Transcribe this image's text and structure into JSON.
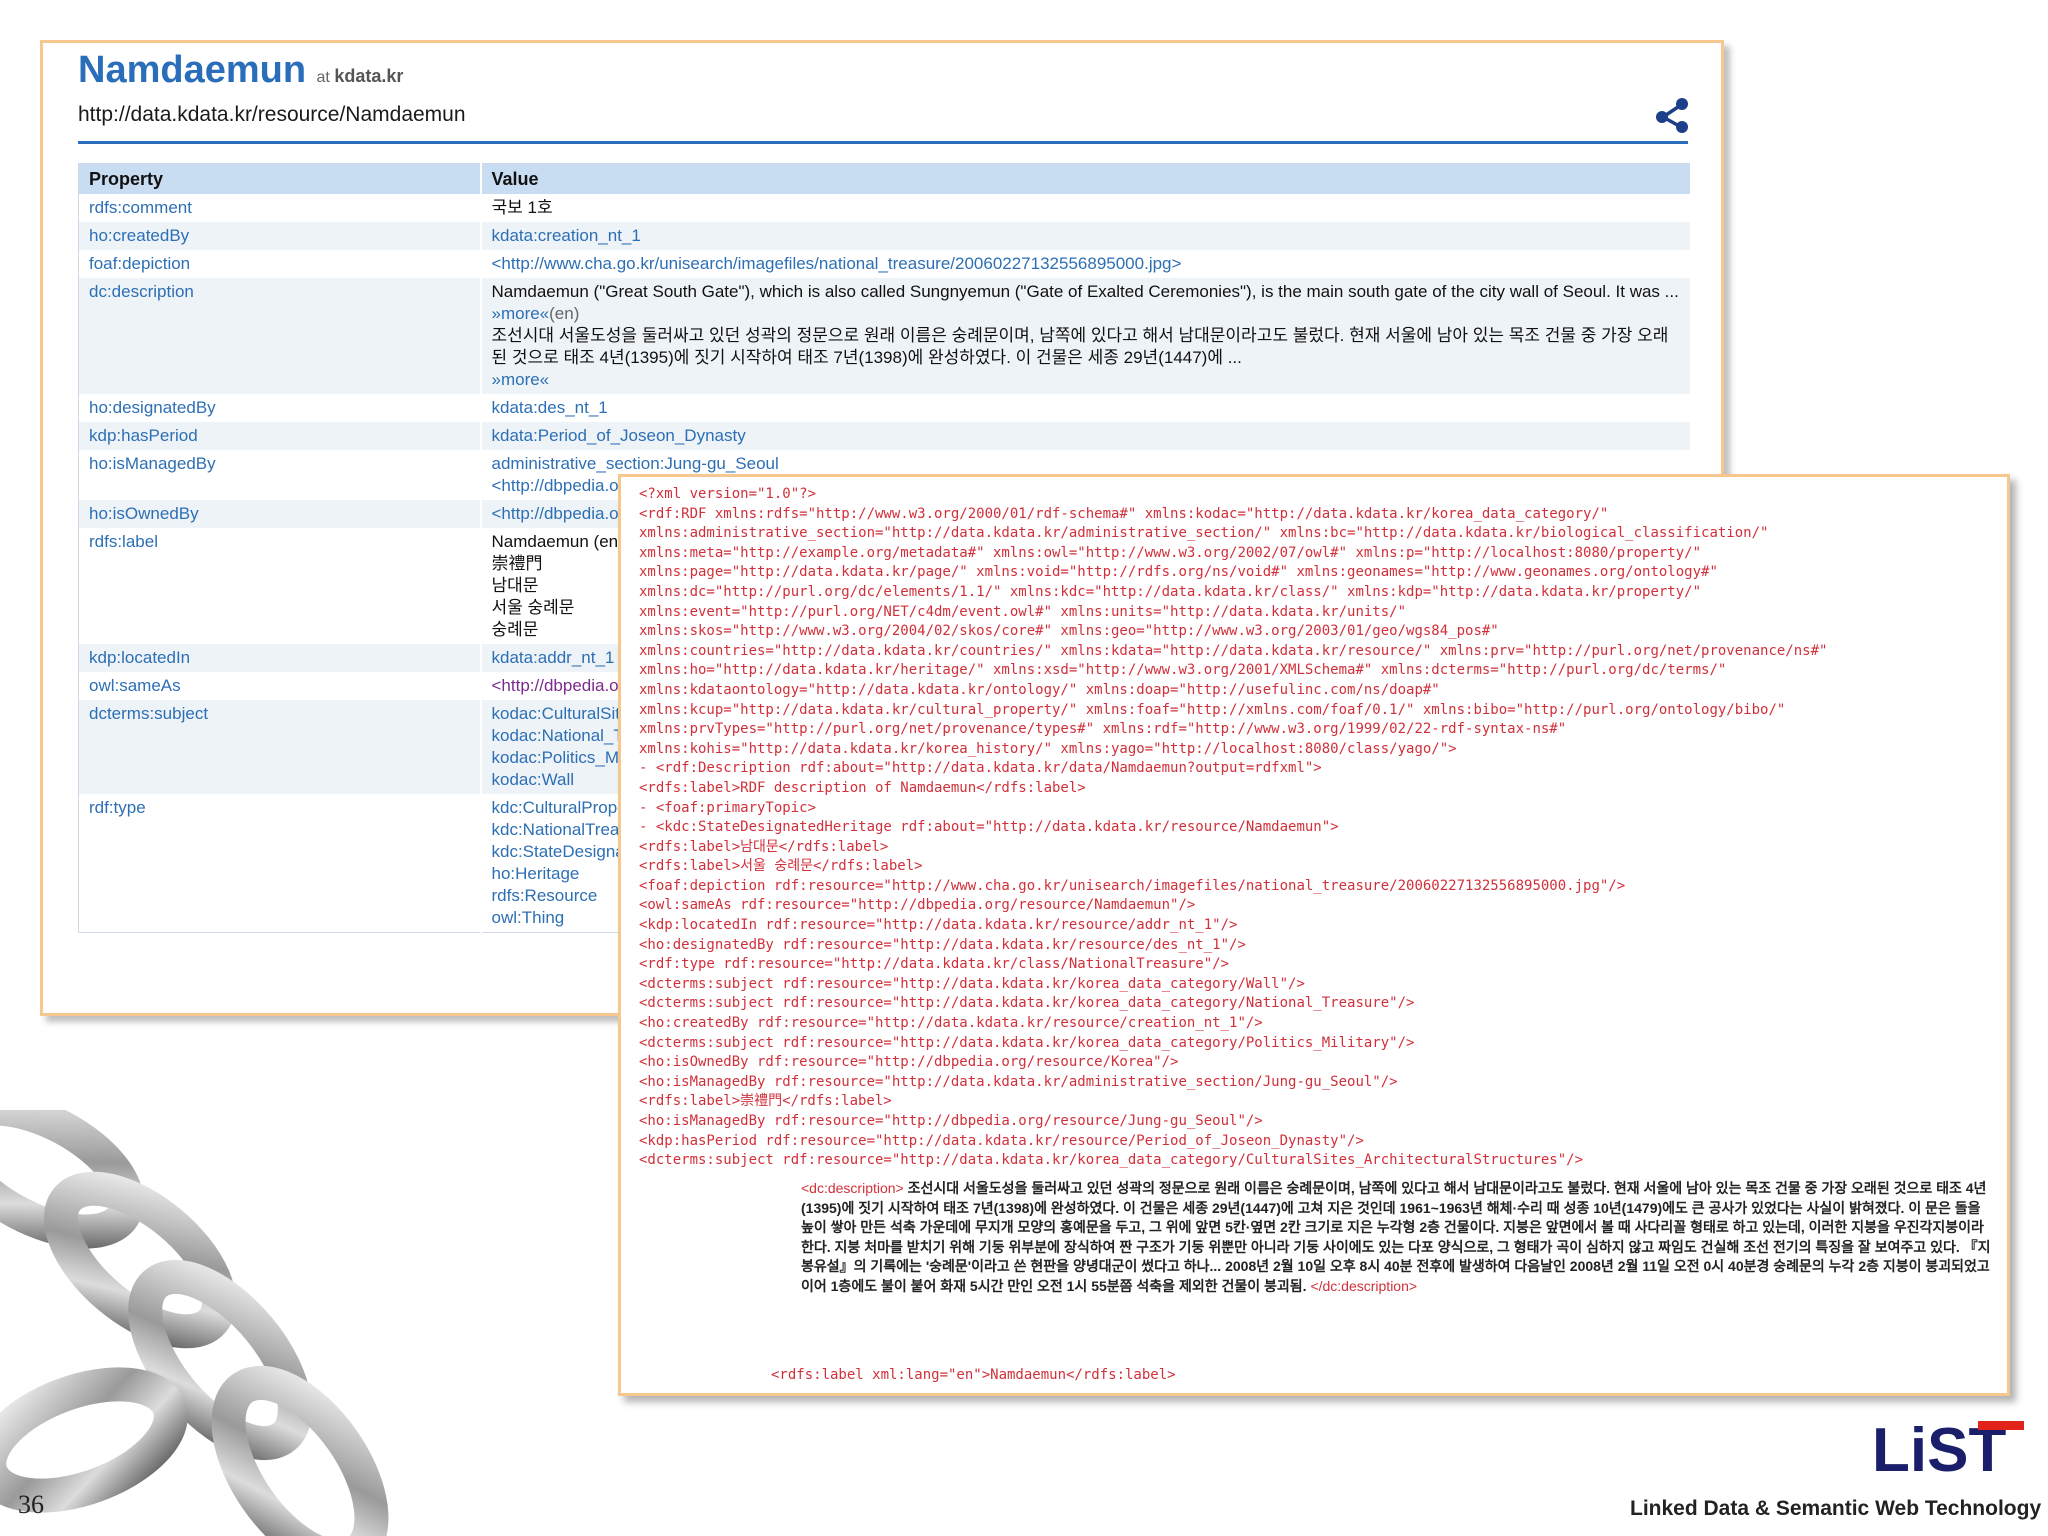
{
  "entity": {
    "title": "Namdaemun",
    "at": "at",
    "source": "kdata.kr",
    "uri": "http://data.kdata.kr/resource/Namdaemun"
  },
  "table": {
    "header": {
      "property": "Property",
      "value": "Value"
    },
    "rows": [
      {
        "property": "rdfs:comment",
        "values": [
          "국보 1호"
        ],
        "kind": "text"
      },
      {
        "property": "ho:createdBy",
        "values": [
          "kdata:creation_nt_1"
        ],
        "kind": "link"
      },
      {
        "property": "foaf:depiction",
        "values": [
          "<http://www.cha.go.kr/unisearch/imagefiles/national_treasure/2006022713255689500​0.jpg>"
        ],
        "kind": "link"
      },
      {
        "property": "dc:description",
        "kind": "text",
        "en_text": "Namdaemun (\"Great South Gate\"), which is also called Sungnyemun (\"Gate of Exalted Ceremonies\"), is the main south gate of the city wall of Seoul. It was ...",
        "en_more": "»more«",
        "en_lang": "(en)",
        "ko_text": "조선시대 서울도성을 둘러싸고 있던 성곽의 정문으로 원래 이름은 숭례문이며, 남쪽에 있다고 해서 남대문이라고도 불렀다. 현재 서울에 남아 있는 목조 건물 중 가장 오래된 것으로 태조 4년(1395)에 짓기 시작하여 태조 7년(1398)에 완성하였다. 이 건물은 세종 29년(1447)에 ...",
        "ko_more": "»more«"
      },
      {
        "property": "ho:designatedBy",
        "values": [
          "kdata:des_nt_1"
        ],
        "kind": "link"
      },
      {
        "property": "kdp:hasPeriod",
        "values": [
          "kdata:Period_of_Joseon_Dynasty"
        ],
        "kind": "link"
      },
      {
        "property": "ho:isManagedBy",
        "values": [
          "administrative_section:Jung-gu_Seoul",
          "<http://dbpedia.org/resource/Jung-gu_Seoul>"
        ],
        "kind": "link"
      },
      {
        "property": "ho:isOwnedBy",
        "values": [
          "<http://dbpedia.org/resource/Korea>"
        ],
        "kind": "link"
      },
      {
        "property": "rdfs:label",
        "values": [
          "Namdaemun (en)",
          "崇禮門",
          "남대문",
          "서울 숭례문",
          "숭례문"
        ],
        "kind": "text"
      },
      {
        "property": "kdp:locatedIn",
        "values": [
          "kdata:addr_nt_1"
        ],
        "kind": "link"
      },
      {
        "property": "owl:sameAs",
        "values": [
          "<http://dbpedia.org/resource/Namdaemun>"
        ],
        "kind": "visited"
      },
      {
        "property": "dcterms:subject",
        "values": [
          "kodac:CulturalSites_ArchitecturalStructures",
          "kodac:National_Treasure",
          "kodac:Politics_Military",
          "kodac:Wall"
        ],
        "kind": "link"
      },
      {
        "property": "rdf:type",
        "values": [
          "kdc:CulturalProperty",
          "kdc:NationalTreasure",
          "kdc:StateDesignatedHeritage",
          "ho:Heritage",
          "rdfs:Resource",
          "owl:Thing"
        ],
        "kind": "link"
      }
    ]
  },
  "xml": {
    "lines": [
      "<?xml version=\"1.0\"?>",
      "<rdf:RDF xmlns:rdfs=\"http://www.w3.org/2000/01/rdf-schema#\" xmlns:kodac=\"http://data.kdata.kr/korea_data_category/\"",
      "xmlns:administrative_section=\"http://data.kdata.kr/administrative_section/\" xmlns:bc=\"http://data.kdata.kr/biological_classification/\"",
      "xmlns:meta=\"http://example.org/metadata#\" xmlns:owl=\"http://www.w3.org/2002/07/owl#\" xmlns:p=\"http://localhost:8080/property/\"",
      "xmlns:page=\"http://data.kdata.kr/page/\" xmlns:void=\"http://rdfs.org/ns/void#\" xmlns:geonames=\"http://www.geonames.org/ontology#\"",
      "xmlns:dc=\"http://purl.org/dc/elements/1.1/\" xmlns:kdc=\"http://data.kdata.kr/class/\" xmlns:kdp=\"http://data.kdata.kr/property/\"",
      "xmlns:event=\"http://purl.org/NET/c4dm/event.owl#\" xmlns:units=\"http://data.kdata.kr/units/\"",
      "xmlns:skos=\"http://www.w3.org/2004/02/skos/core#\" xmlns:geo=\"http://www.w3.org/2003/01/geo/wgs84_pos#\"",
      "xmlns:countries=\"http://data.kdata.kr/countries/\" xmlns:kdata=\"http://data.kdata.kr/resource/\" xmlns:prv=\"http://purl.org/net/provenance/ns#\"",
      "xmlns:ho=\"http://data.kdata.kr/heritage/\" xmlns:xsd=\"http://www.w3.org/2001/XMLSchema#\" xmlns:dcterms=\"http://purl.org/dc/terms/\"",
      "xmlns:kdataontology=\"http://data.kdata.kr/ontology/\" xmlns:doap=\"http://usefulinc.com/ns/doap#\"",
      "xmlns:kcup=\"http://data.kdata.kr/cultural_property/\" xmlns:foaf=\"http://xmlns.com/foaf/0.1/\" xmlns:bibo=\"http://purl.org/ontology/bibo/\"",
      "xmlns:prvTypes=\"http://purl.org/net/provenance/types#\" xmlns:rdf=\"http://www.w3.org/1999/02/22-rdf-syntax-ns#\"",
      "xmlns:kohis=\"http://data.kdata.kr/korea_history/\" xmlns:yago=\"http://localhost:8080/class/yago/\">",
      "  - <rdf:Description rdf:about=\"http://data.kdata.kr/data/Namdaemun?output=rdfxml\">",
      "      <rdfs:label>RDF description of Namdaemun</rdfs:label>",
      "    - <foaf:primaryTopic>",
      "      - <kdc:StateDesignatedHeritage rdf:about=\"http://data.kdata.kr/resource/Namdaemun\">",
      "          <rdfs:label>남대문</rdfs:label>",
      "          <rdfs:label>서울 숭례문</rdfs:label>",
      "          <foaf:depiction rdf:resource=\"http://www.cha.go.kr/unisearch/imagefiles/national_treasure/20060227132556895000.jpg\"/>",
      "          <owl:sameAs rdf:resource=\"http://dbpedia.org/resource/Namdaemun\"/>",
      "          <kdp:locatedIn rdf:resource=\"http://data.kdata.kr/resource/addr_nt_1\"/>",
      "          <ho:designatedBy rdf:resource=\"http://data.kdata.kr/resource/des_nt_1\"/>",
      "          <rdf:type rdf:resource=\"http://data.kdata.kr/class/NationalTreasure\"/>",
      "          <dcterms:subject rdf:resource=\"http://data.kdata.kr/korea_data_category/Wall\"/>",
      "          <dcterms:subject rdf:resource=\"http://data.kdata.kr/korea_data_category/National_Treasure\"/>",
      "          <ho:createdBy rdf:resource=\"http://data.kdata.kr/resource/creation_nt_1\"/>",
      "          <dcterms:subject rdf:resource=\"http://data.kdata.kr/korea_data_category/Politics_Military\"/>",
      "          <ho:isOwnedBy rdf:resource=\"http://dbpedia.org/resource/Korea\"/>",
      "          <ho:isManagedBy rdf:resource=\"http://data.kdata.kr/administrative_section/Jung-gu_Seoul\"/>",
      "          <rdfs:label>崇禮門</rdfs:label>",
      "          <ho:isManagedBy rdf:resource=\"http://dbpedia.org/resource/Jung-gu_Seoul\"/>",
      "          <kdp:hasPeriod rdf:resource=\"http://data.kdata.kr/resource/Period_of_Joseon_Dynasty\"/>",
      "          <dcterms:subject rdf:resource=\"http://data.kdata.kr/korea_data_category/CulturalSites_ArchitecturalStructures\"/>"
    ],
    "desc_open": "<dc:description>",
    "desc_text": "조선시대 서울도성을 둘러싸고 있던 성곽의 정문으로 원래 이름은 숭례문이며, 남쪽에 있다고 해서 남대문이라고도 불렀다. 현재 서울에 남아 있는 목조 건물 중 가장 오래된 것으로 태조 4년(1395)에 짓기 시작하여 태조 7년(1398)에 완성하였다. 이 건물은 세종 29년(1447)에 고쳐 지은 것인데 1961~1963년 해체·수리 때 성종 10년(1479)에도 큰 공사가 있었다는 사실이 밝혀졌다. 이 문은 돌을 높이 쌓아 만든 석축 가운데에 무지개 모양의 홍예문을 두고, 그 위에 앞면 5칸·옆면 2칸 크기로 지은 누각형 2층 건물이다. 지붕은 앞면에서 볼 때 사다리꼴 형태로 하고 있는데, 이러한 지붕을 우진각지붕이라 한다. 지붕 처마를 받치기 위해 기둥 위부분에 장식하여 짠 구조가 기둥 위뿐만 아니라 기둥 사이에도 있는 다포 양식으로, 그 형태가 곡이 심하지 않고 짜임도 건실해 조선 전기의 특징을 잘 보여주고 있다. 『지봉유설』의 기록에는 '숭례문'이라고 쓴 현판을 양녕대군이 썼다고 하나... 2008년 2월 10일 오후 8시 40분 전후에 발생하여 다음날인 2008년 2월 11일 오전 0시 40분경 숭례문의 누각 2층 지붕이 붕괴되었고 이어 1층에도 불이 붙어 화재 5시간 만인 오전 1시 55분쯤 석축을 제외한 건물이 붕괴됨.",
    "desc_close": "</dc:description>",
    "last_line": "<rdfs:label xml:lang=\"en\">Namdaemun</rdfs:label>"
  },
  "footer": {
    "page_number": "36",
    "course_title": "Linked Data & Semantic Web Technology",
    "logo_text": "LiST"
  },
  "colors": {
    "title_blue": "#2a6ebb",
    "link_blue": "#2d6fb4",
    "xml_red": "#d1303a",
    "panel_border": "#f6c890",
    "header_bg": "#c9ddf2",
    "logo_navy": "#1b1f6b",
    "logo_red": "#e2231a"
  }
}
